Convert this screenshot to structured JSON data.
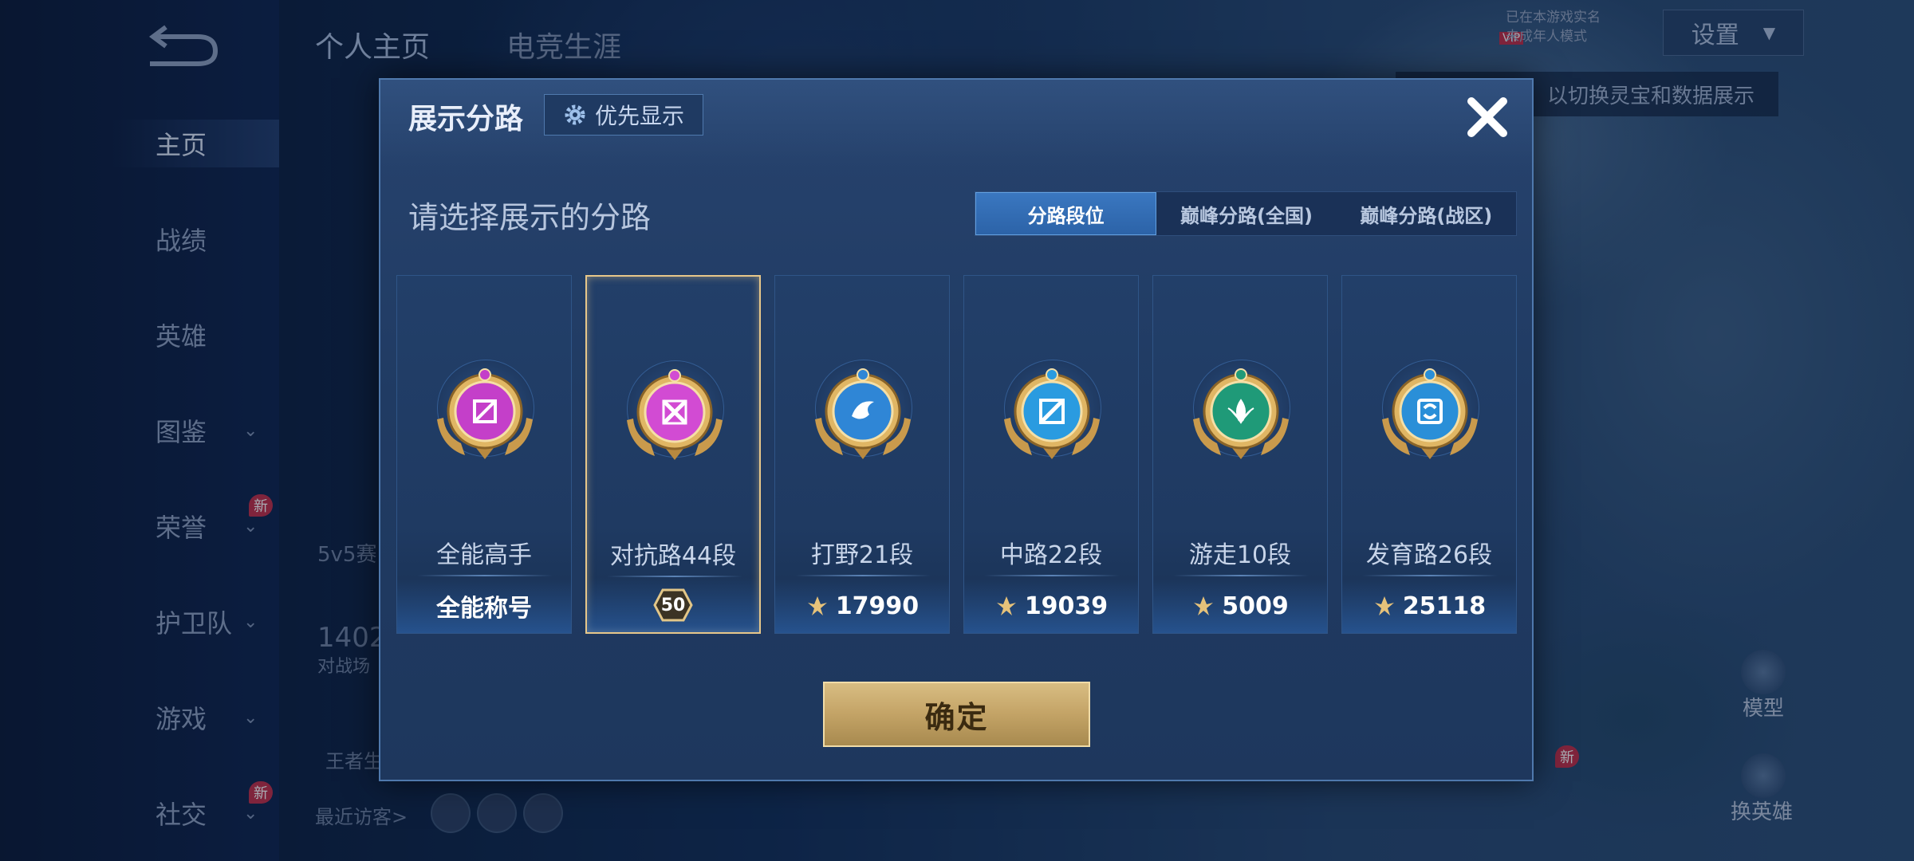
{
  "sidebar": {
    "items": [
      {
        "label": "主页",
        "active": true,
        "has_chevron": false,
        "new": false
      },
      {
        "label": "战绩",
        "active": false,
        "has_chevron": false,
        "new": false
      },
      {
        "label": "英雄",
        "active": false,
        "has_chevron": false,
        "new": false
      },
      {
        "label": "图鉴",
        "active": false,
        "has_chevron": true,
        "new": false
      },
      {
        "label": "荣誉",
        "active": false,
        "has_chevron": true,
        "new": true
      },
      {
        "label": "护卫队",
        "active": false,
        "has_chevron": true,
        "new": false
      },
      {
        "label": "游戏",
        "active": false,
        "has_chevron": true,
        "new": false
      },
      {
        "label": "社交",
        "active": false,
        "has_chevron": true,
        "new": true
      }
    ],
    "new_badge": "新"
  },
  "top_tabs": [
    {
      "label": "个人主页",
      "active": true
    },
    {
      "label": "电竞生涯",
      "active": false
    }
  ],
  "background": {
    "settings_label": "设置",
    "vip_line1": "已在本游戏实名",
    "vip_line2": "未成年人模式",
    "vip_badge": "VIP",
    "tip_text": "以切换灵宝和数据展示",
    "stat_5v5": "5v5赛",
    "stat_number": "1402",
    "stat_label": "对战场",
    "king_label": "王者生",
    "visitors_label": "最近访客>",
    "model_label": "模型",
    "switch_hero_label": "换英雄",
    "new_badge": "新"
  },
  "modal": {
    "title": "展示分路",
    "priority_label": "优先显示",
    "subtitle": "请选择展示的分路",
    "segments": [
      {
        "label": "分路段位",
        "active": true
      },
      {
        "label": "巅峰分路(全国)",
        "active": false
      },
      {
        "label": "巅峰分路(战区)",
        "active": false
      }
    ],
    "cards": [
      {
        "name": "全能高手",
        "footer": "全能称号",
        "footer_type": "title",
        "selected": false,
        "badge_color": "#c43fc9",
        "icon": "allround-icon"
      },
      {
        "name": "对抗路44段",
        "footer": "50",
        "footer_type": "star-level",
        "selected": true,
        "badge_color": "#d24bd3",
        "icon": "clash-lane-icon"
      },
      {
        "name": "打野21段",
        "footer": "17990",
        "footer_type": "points",
        "selected": false,
        "badge_color": "#2f86d6",
        "icon": "jungle-icon"
      },
      {
        "name": "中路22段",
        "footer": "19039",
        "footer_type": "points",
        "selected": false,
        "badge_color": "#2a9be0",
        "icon": "mid-lane-icon"
      },
      {
        "name": "游走10段",
        "footer": "5009",
        "footer_type": "points",
        "selected": false,
        "badge_color": "#1f9a78",
        "icon": "roam-icon"
      },
      {
        "name": "发育路26段",
        "footer": "25118",
        "footer_type": "points",
        "selected": false,
        "badge_color": "#2a8fd8",
        "icon": "farm-lane-icon"
      }
    ],
    "confirm_label": "确定"
  }
}
